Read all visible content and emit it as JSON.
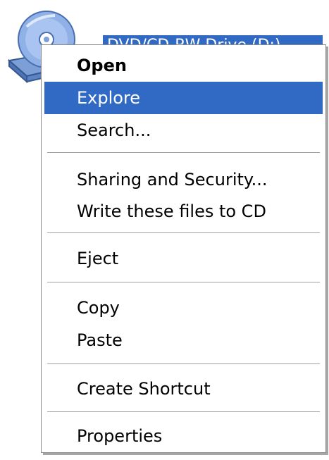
{
  "desktop": {
    "drive_label": "DVD/CD-RW Drive (D:)"
  },
  "context_menu": {
    "groups": [
      [
        "Open",
        "Explore",
        "Search..."
      ],
      [
        "Sharing and Security...",
        "Write these files to CD"
      ],
      [
        "Eject"
      ],
      [
        "Copy",
        "Paste"
      ],
      [
        "Create Shortcut"
      ],
      [
        "Properties"
      ]
    ],
    "default_item": "Open",
    "highlighted_item": "Explore"
  },
  "colors": {
    "highlight": "#316ac5",
    "highlight_text": "#ffffff",
    "separator": "#a0a0a0"
  },
  "icons": [
    "cd-drive-icon"
  ]
}
